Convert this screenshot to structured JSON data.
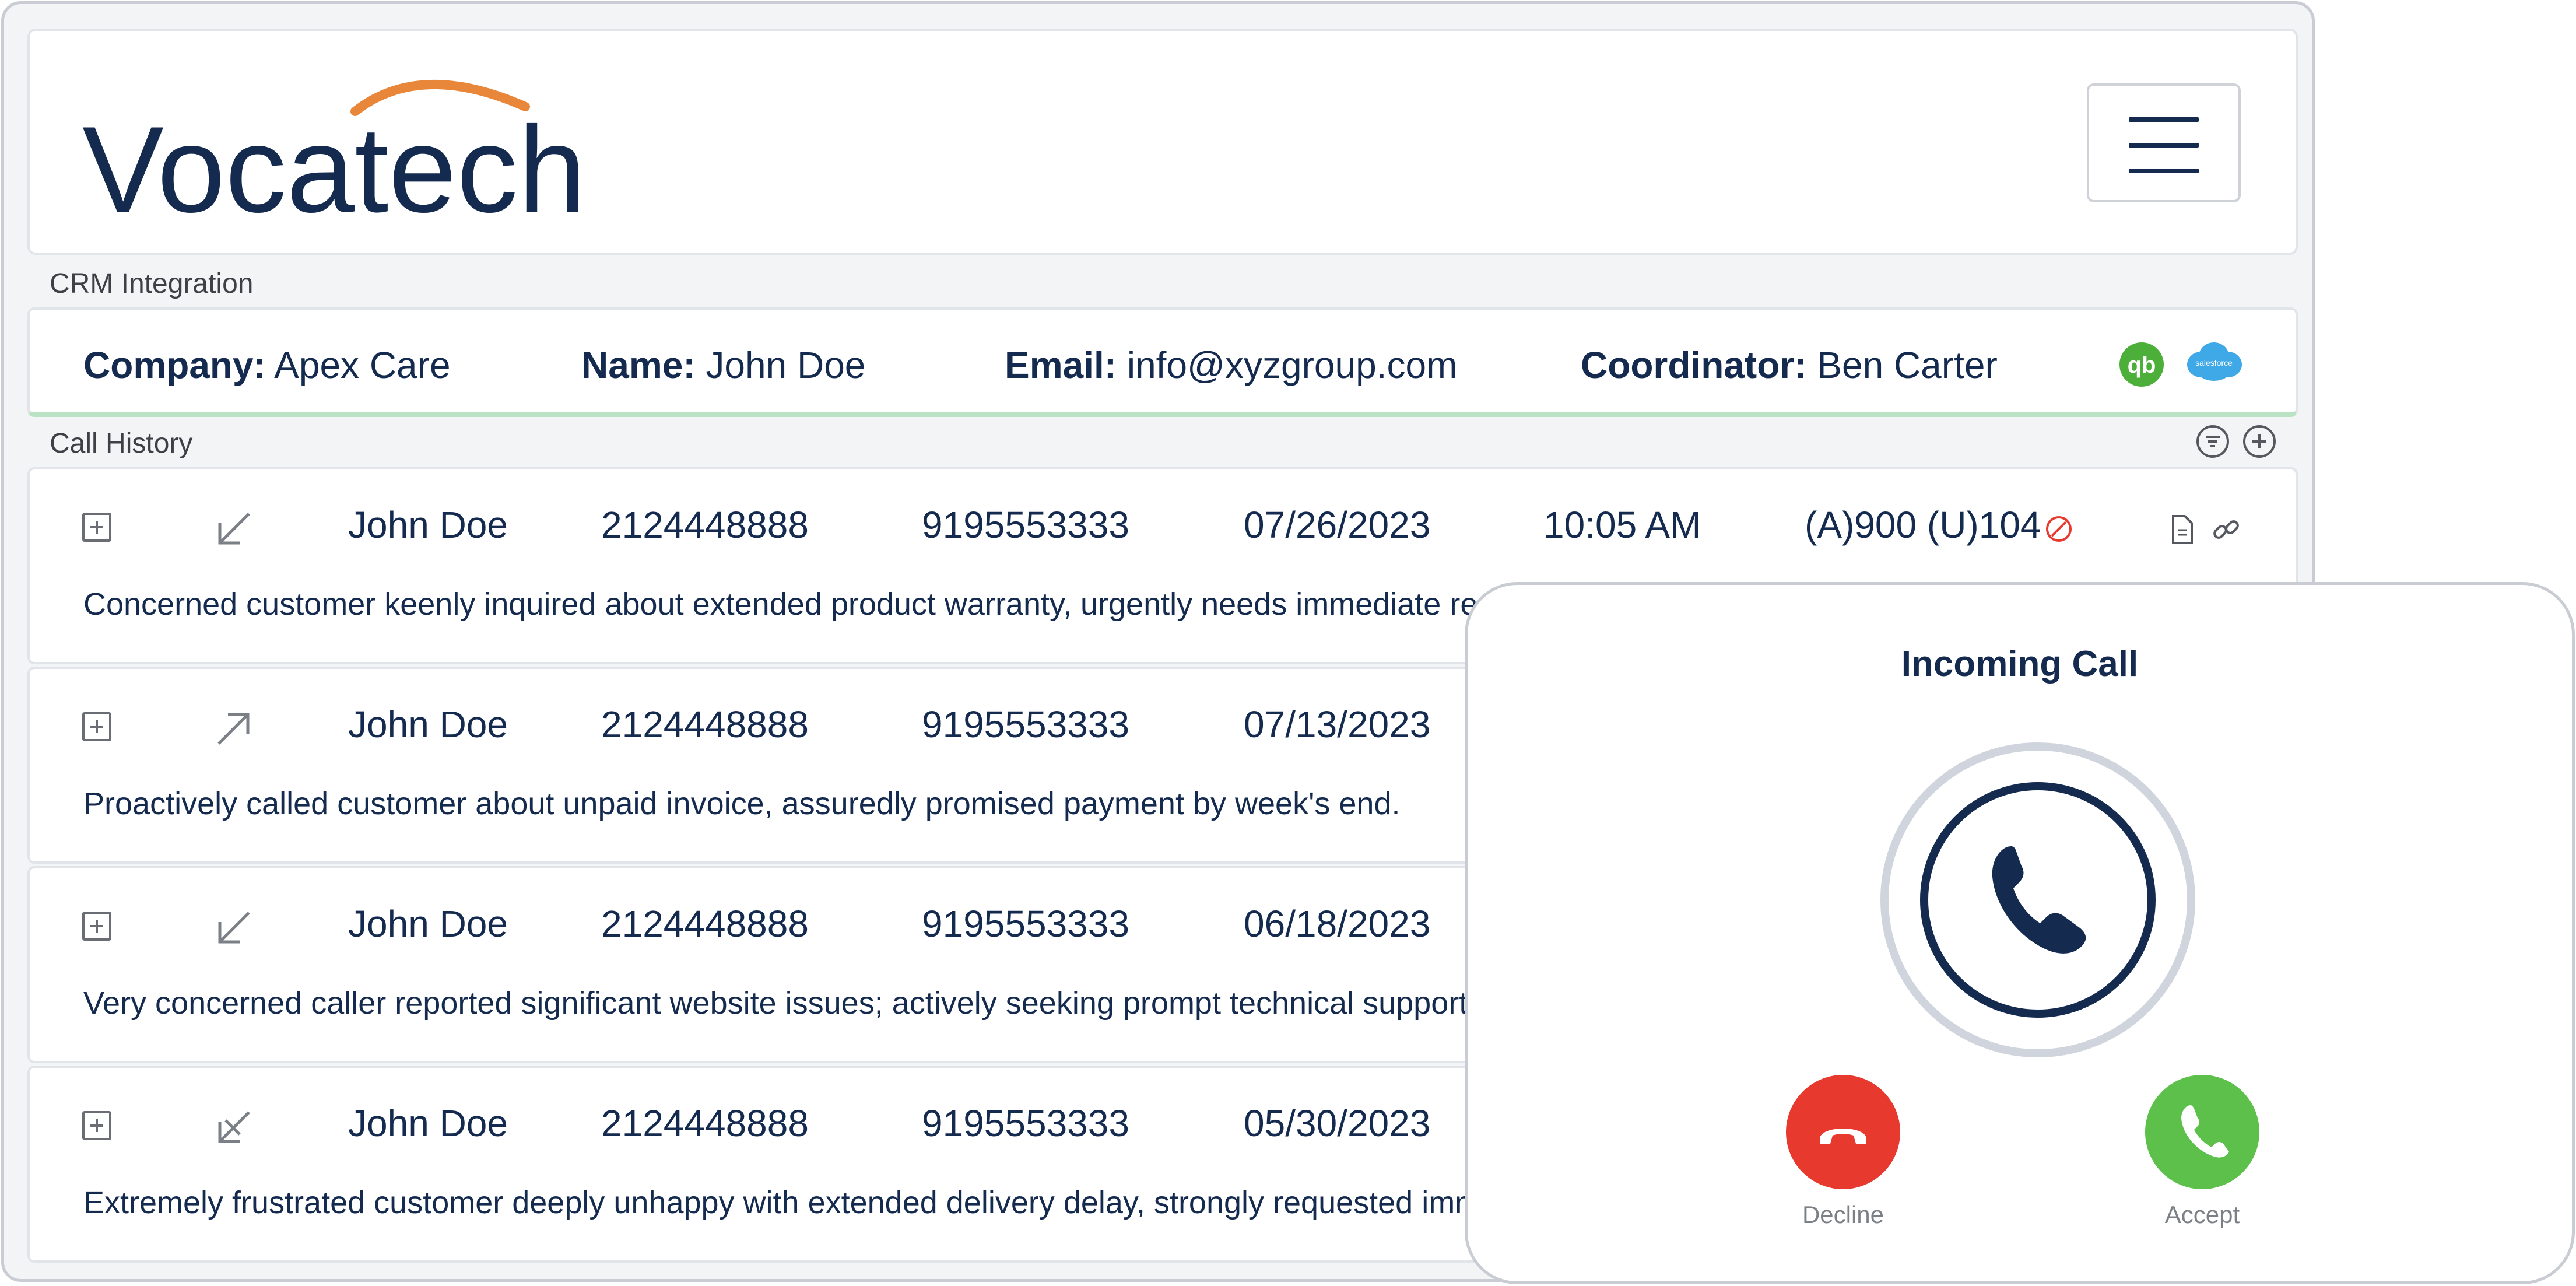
{
  "brand": {
    "name": "Vocatech",
    "logo_color": "#142a4e",
    "swoosh_color": "#e8863a"
  },
  "header": {
    "menu_icon": "hamburger-menu-icon"
  },
  "crm": {
    "section_label": "CRM Integration",
    "company_key": "Company:",
    "company_value": "Apex Care",
    "name_key": "Name:",
    "name_value": "John Doe",
    "email_key": "Email:",
    "email_value": "info@xyzgroup.com",
    "coordinator_key": "Coordinator:",
    "coordinator_value": "Ben Carter",
    "integrations": [
      {
        "icon": "quickbooks-logo-icon",
        "label": "qb",
        "color": "#4caf3a"
      },
      {
        "icon": "salesforce-logo-icon",
        "label": "salesforce",
        "color": "#3fa9e8"
      }
    ]
  },
  "history": {
    "section_label": "Call History",
    "actions": [
      "filter-icon",
      "add-icon"
    ],
    "rows": [
      {
        "direction": "incoming",
        "name": "John Doe",
        "from": "2124448888",
        "to": "9195553333",
        "date": "07/26/2023",
        "time": "10:05 AM",
        "duration": "(A)900 (U)104",
        "status_icon": "blocked-icon",
        "summary": "Concerned customer keenly inquired about extended product warranty, urgently needs immediate repl"
      },
      {
        "direction": "outgoing",
        "name": "John Doe",
        "from": "2124448888",
        "to": "9195553333",
        "date": "07/13/2023",
        "summary": "Proactively called customer about unpaid invoice, assuredly promised payment by week's end."
      },
      {
        "direction": "incoming",
        "name": "John Doe",
        "from": "2124448888",
        "to": "9195553333",
        "date": "06/18/2023",
        "summary": "Very concerned caller reported significant website issues; actively seeking prompt technical support to"
      },
      {
        "direction": "missed",
        "name": "John Doe",
        "from": "2124448888",
        "to": "9195553333",
        "date": "05/30/2023",
        "summary": "Extremely frustrated customer deeply unhappy with extended delivery delay, strongly requested imme"
      }
    ]
  },
  "incoming_call": {
    "title": "Incoming Call",
    "decline_label": "Decline",
    "accept_label": "Accept",
    "decline_color": "#e8392f",
    "accept_color": "#5cc04a"
  }
}
